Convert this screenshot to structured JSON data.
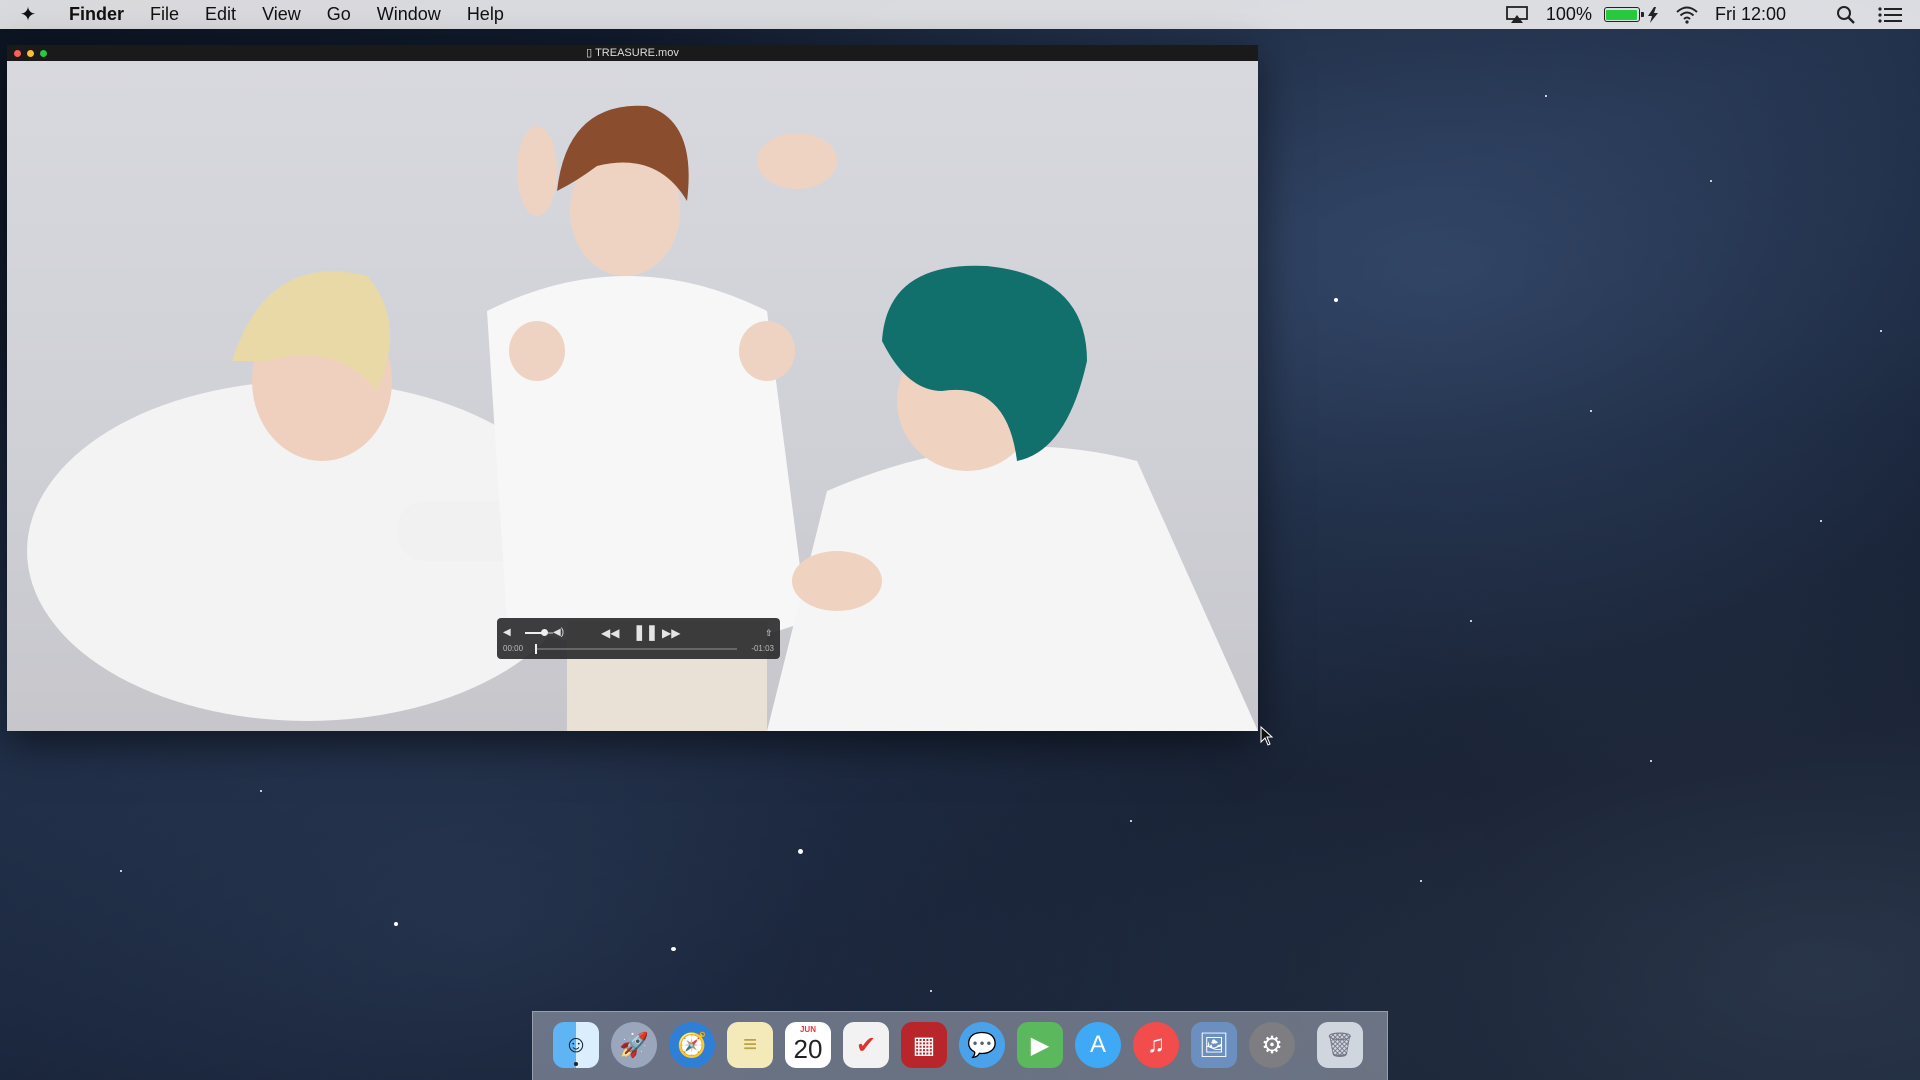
{
  "menubar": {
    "app_name": "Finder",
    "items": [
      "File",
      "Edit",
      "View",
      "Go",
      "Window",
      "Help"
    ],
    "battery_percent": "100%",
    "clock": "Fri 12:00",
    "icons": [
      "airplay-icon",
      "battery-icon",
      "wifi-icon",
      "spotlight-search-icon",
      "notification-center-icon"
    ]
  },
  "window": {
    "title": "TREASURE.mov"
  },
  "player": {
    "elapsed": "00:00",
    "remaining": "-01:03",
    "progress": 0.0,
    "volume": 0.7
  },
  "dock": {
    "apps": [
      {
        "name": "Finder",
        "icon": "finder-icon",
        "color": "#3b8ee8"
      },
      {
        "name": "Launchpad",
        "icon": "launchpad-icon",
        "color": "#8f9db5"
      },
      {
        "name": "Safari",
        "icon": "safari-icon",
        "color": "#2f7fd6"
      },
      {
        "name": "Notes",
        "icon": "notes-icon",
        "color": "#f4e9b8"
      },
      {
        "name": "Calendar",
        "icon": "calendar-icon",
        "month": "JUN",
        "day": "20"
      },
      {
        "name": "Reminders",
        "icon": "reminders-icon",
        "color": "#f2f2f2"
      },
      {
        "name": "Photo Booth",
        "icon": "photo-booth-icon",
        "color": "#b8262c"
      },
      {
        "name": "Messages",
        "icon": "messages-icon",
        "color": "#4aa3ea"
      },
      {
        "name": "FaceTime",
        "icon": "facetime-icon",
        "color": "#5cb85c"
      },
      {
        "name": "App Store",
        "icon": "app-store-icon",
        "color": "#3fa9f5"
      },
      {
        "name": "iTunes",
        "icon": "itunes-icon",
        "color": "#f24c4c"
      },
      {
        "name": "Preview",
        "icon": "preview-icon",
        "color": "#6b8fbf"
      },
      {
        "name": "System Preferences",
        "icon": "system-preferences-icon",
        "color": "#7d7d82"
      },
      {
        "name": "Trash",
        "icon": "trash-icon",
        "color": "#cfd6de"
      }
    ]
  }
}
